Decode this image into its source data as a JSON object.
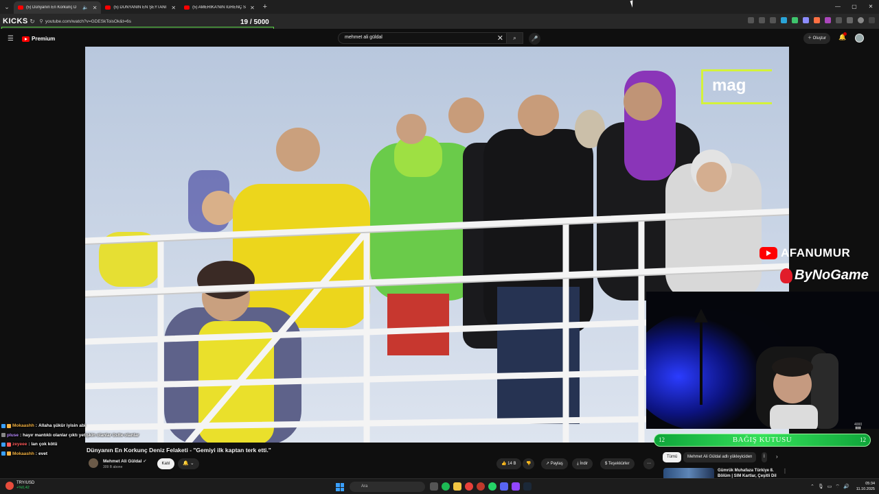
{
  "browser": {
    "tabs": [
      {
        "title": "(5) Dünyanın En Korkunç D",
        "active": true
      },
      {
        "title": "(5) DÜNYANIN EN ŞEYTANİ BA",
        "active": false
      },
      {
        "title": "(5) AMERİKA'NIN İĞRENÇ S*KS",
        "active": false
      }
    ],
    "overlay_label": "KICKS",
    "url": "youtube.com/watch?v=GDESkToisOk&t=6s",
    "counter": "19  / 5000"
  },
  "youtube": {
    "brand": "Premium",
    "search_query": "mehmet ali güldal",
    "create_label": "Oluştur"
  },
  "video": {
    "watermark": "mag",
    "title": "Dünyanın En Korkunç Deniz Felaketi - \"Gemiyi ilk kaptan terk etti.\"",
    "channel": "Mehmet Ali Güldal",
    "subscribers": "309 B abone",
    "join_label": "Katıl",
    "likes": "14 B",
    "share_label": "Paylaş",
    "download_label": "İndir",
    "thanks_label": "Teşekkürler"
  },
  "stream_overlay": {
    "channel1": "AFANUMUR",
    "channel2": "ByNoGame",
    "donation": {
      "label": "BAĞIŞ KUTUSU",
      "left": "12",
      "right": "12"
    },
    "meter": "4000"
  },
  "chat": [
    {
      "user": "Mokaashh",
      "message": "Allaha şükür iyisin abi",
      "color": "#f5b342"
    },
    {
      "user": "pluse",
      "message": "hayır mantıklı olanlar çıktı yetişkin olanlar üstte olanlar",
      "color": "#b98bff"
    },
    {
      "user": "zeyeee",
      "message": "lan çok kötü",
      "color": "#ff5a5a"
    },
    {
      "user": "Mokaashh",
      "message": "evet",
      "color": "#f5b342"
    }
  ],
  "sidebar": {
    "chips": [
      "Tümü",
      "Mehmet Ali Güldal adlı yükleyiciden",
      "İ"
    ],
    "rec_title": "Gümrük Muhafaza Türkiye 8. Bölüm | SIM Kartlar, Çeşitli Dil"
  },
  "taskbar": {
    "ticker": "TRY/USD",
    "ticker_change": "+%0,42",
    "search_placeholder": "Ara",
    "time": "05:34",
    "date": "11.10.2025"
  },
  "colors": {
    "accent_red": "#ff0000",
    "donation_green": "#35e05a",
    "highlight_green": "#5bd646"
  }
}
